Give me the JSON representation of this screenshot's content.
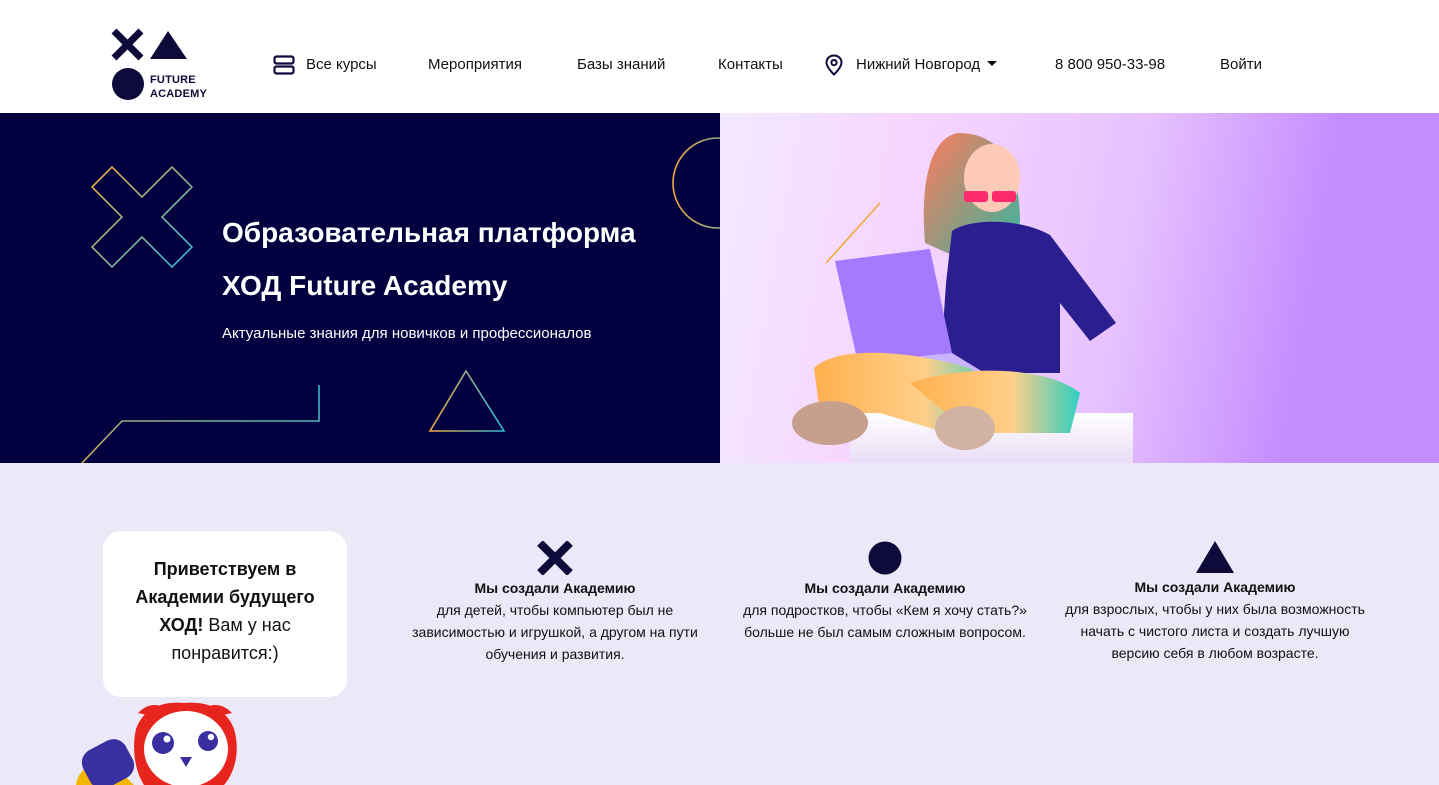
{
  "header": {
    "logo_text_line1": "FUTURE",
    "logo_text_line2": "ACADEMY",
    "nav": {
      "courses": "Все курсы",
      "events": "Мероприятия",
      "knowledge": "Базы знаний",
      "contacts": "Контакты",
      "city": "Нижний Новгород",
      "phone": "8 800 950-33-98",
      "login": "Войти"
    }
  },
  "hero": {
    "title_line1": "Образовательная платформа",
    "title_line2": "ХОД Future Academy",
    "subtitle": "Актуальные знания для новичков и профессионалов"
  },
  "welcome": {
    "bold": "Приветствуем в Академии будущего ХОД!",
    "rest": " Вам у нас понравится:)"
  },
  "features": [
    {
      "icon": "cross-icon",
      "head": "Мы создали Академию",
      "body": "для детей, чтобы компьютер был не зависимостью и игрушкой, а другом на пути обучения и развития."
    },
    {
      "icon": "circle-icon",
      "head": "Мы создали Академию",
      "body": "для подростков, чтобы «Кем я хочу стать?» больше не был самым сложным вопросом."
    },
    {
      "icon": "triangle-icon",
      "head": "Мы создали Академию",
      "body": "для взрослых, чтобы у них была возможность начать с чистого листа и создать лучшую версию себя в любом возрасте."
    }
  ],
  "colors": {
    "brand_navy": "#0e0b3a",
    "hero_dark": "#03003f",
    "lower_bg": "#ebe8f7",
    "accent_orange": "#f2a93b",
    "accent_teal": "#2fb7d6"
  }
}
